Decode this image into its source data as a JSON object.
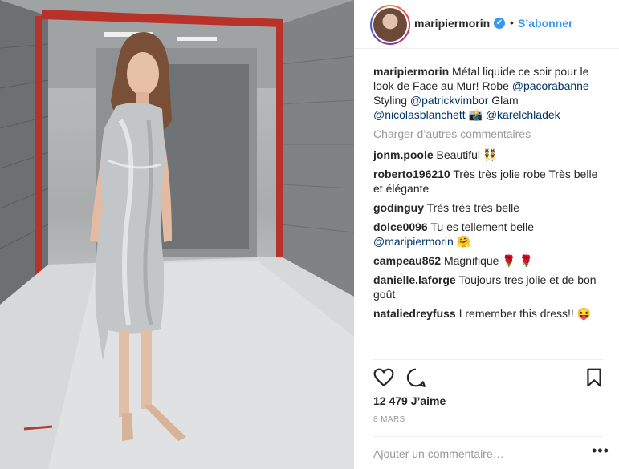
{
  "header": {
    "username": "maripiermorin",
    "verified_icon": "✔",
    "separator": "•",
    "follow_label": "S’abonner"
  },
  "caption": {
    "user": "maripiermorin",
    "text_1": " Métal liquide ce soir pour le look de Face au Mur! Robe ",
    "mention_1": "@pacorabanne",
    "text_2": " Styling ",
    "mention_2": "@patrickvimbor",
    "text_3": " Glam ",
    "mention_3": "@nicolasblanchett",
    "text_4": " 📸 ",
    "mention_4": "@karelchladek"
  },
  "load_more_label": "Charger d’autres commentaires",
  "comments": [
    {
      "user": "jonm.poole",
      "text": " Beautiful 👯"
    },
    {
      "user": "roberto196210",
      "text": " Très très jolie robe Très belle et élégante"
    },
    {
      "user": "godinguy",
      "text": " Très très très belle"
    },
    {
      "user": "dolce0096",
      "text": " Tu es tellement belle ",
      "mention": "@maripiermorin",
      "text_after": " 🤗"
    },
    {
      "user": "campeau862",
      "text": " Magnifique 🌹 🌹"
    },
    {
      "user": "danielle.laforge",
      "text": " Toujours tres jolie et de bon goût"
    },
    {
      "user": "nataliedreyfuss",
      "text": " I remember this dress!! 😝"
    }
  ],
  "icons": {
    "like": "heart-icon",
    "comment": "comment-icon",
    "save": "bookmark-icon",
    "options": "more-options-icon"
  },
  "likes_label": "12 479 J’aime",
  "date_label": "8 MARS",
  "add_comment": {
    "placeholder": "Ajouter un commentaire…"
  },
  "options_glyph": "•••"
}
